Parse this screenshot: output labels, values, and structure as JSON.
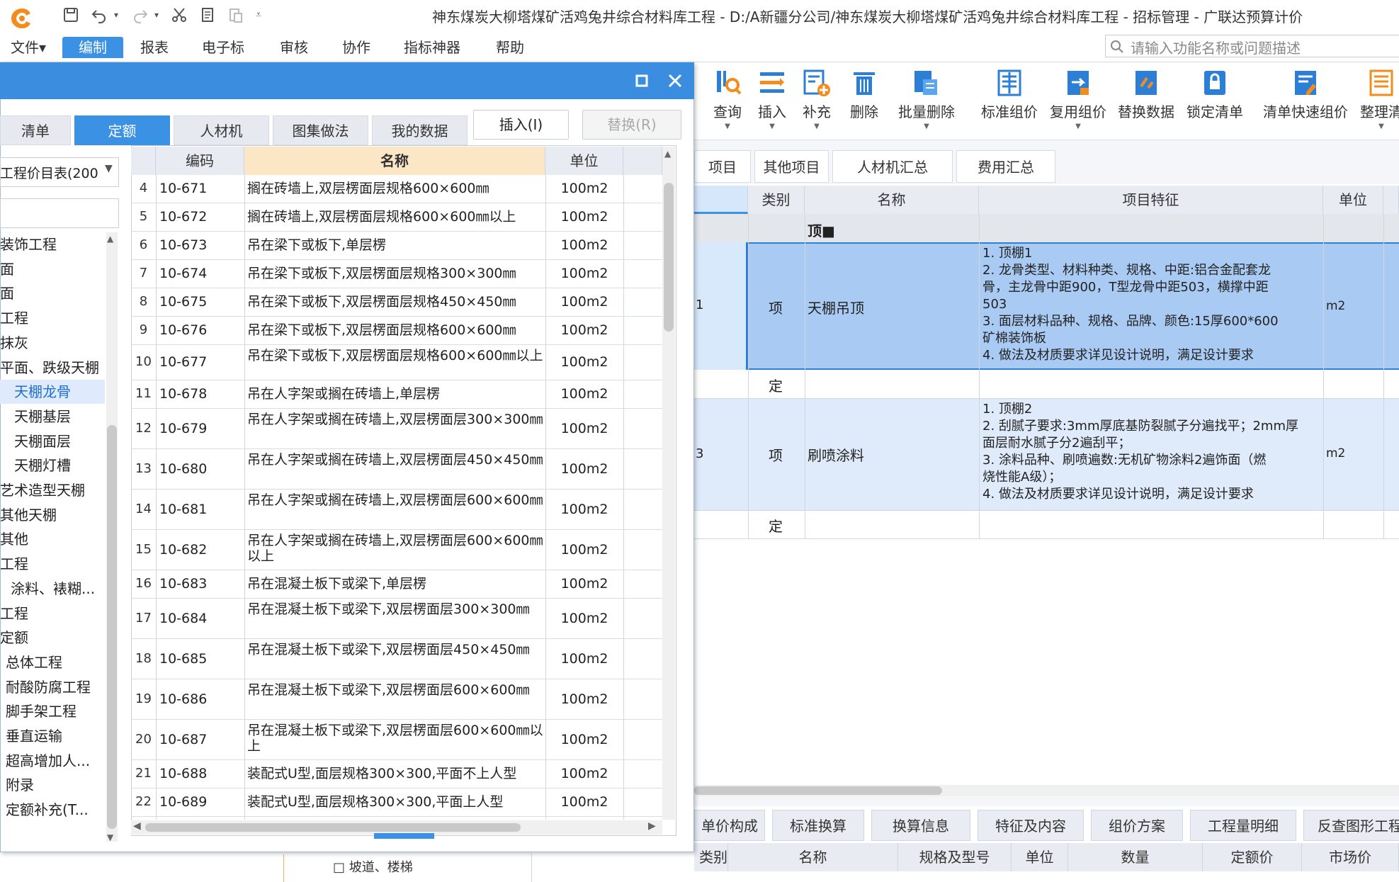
{
  "app": {
    "title": "神东煤炭大柳塔煤矿活鸡兔井综合材料库工程 - D:/A新疆分公司/神东煤炭大柳塔煤矿活鸡兔井综合材料库工程 - 招标管理 - 广联达预算计价",
    "brand_color": "#3b8de0"
  },
  "quick_access": {
    "save_icon": "save-icon",
    "undo_icon": "undo-icon",
    "redo_icon": "redo-icon",
    "cut_icon": "cut-icon",
    "copy_icon": "copy-icon",
    "paste_icon": "paste-icon",
    "more_icon": "more-icon"
  },
  "menu": {
    "items": [
      "文件▾",
      "编制",
      "报表",
      "电子标",
      "审核",
      "协作",
      "指标神器",
      "帮助"
    ],
    "active": "编制"
  },
  "search": {
    "placeholder": "请输入功能名称或问题描述"
  },
  "ribbon": {
    "buttons": [
      "查询",
      "插入",
      "补充",
      "删除",
      "批量删除",
      "标准组价",
      "复用组价",
      "替换数据",
      "锁定清单",
      "清单快速组价",
      "整理清"
    ]
  },
  "right_tabs": [
    "项目",
    "其他项目",
    "人材机汇总",
    "费用汇总"
  ],
  "right_table": {
    "headers": [
      "类别",
      "名称",
      "项目特征",
      "单位"
    ],
    "group_row": "顶■",
    "rows": [
      {
        "code_suffix": "1",
        "type": "项",
        "name": "天棚吊顶",
        "feature": [
          "1. 顶棚1",
          "2. 龙骨类型、材料种类、规格、中距:铝合金配套龙",
          "骨，主龙骨中距900，T型龙骨中距503，横撑中距",
          "503",
          "3. 面层材料品种、规格、品牌、颜色:15厚600*600",
          "矿棉装饰板",
          "4. 做法及材质要求详见设计说明，满足设计要求"
        ],
        "unit": "m2"
      },
      {
        "type": "定"
      },
      {
        "code_suffix": "3",
        "type": "项",
        "name": "刷喷涂料",
        "feature": [
          "1. 顶棚2",
          "2. 刮腻子要求:3mm厚底基防裂腻子分遍找平；2mm厚",
          "面层耐水腻子分2遍刮平；",
          "3. 涂料品种、刷喷遍数:无机矿物涂料2遍饰面（燃",
          "烧性能A级）；",
          "4. 做法及材质要求详见设计说明，满足设计要求"
        ],
        "unit": "m2"
      },
      {
        "type": "定"
      }
    ]
  },
  "bottom_tabs": [
    "单价构成",
    "标准换算",
    "换算信息",
    "特征及内容",
    "组价方案",
    "工程量明细",
    "反查图形工程"
  ],
  "bottom_headers": [
    "类别",
    "名称",
    "规格及型号",
    "单位",
    "数量",
    "定额价",
    "市场价"
  ],
  "dialog": {
    "tabs": [
      "清单",
      "定额",
      "人材机",
      "图集做法",
      "我的数据"
    ],
    "active_tab": "定额",
    "insert_label": "插入(I)",
    "replace_label": "替换(R)",
    "restore_icon": "restore-icon",
    "close_icon": "close-icon",
    "library_select": "工程价目表(200",
    "tree": [
      {
        "label": "装饰工程",
        "sel": false
      },
      {
        "label": "面",
        "sel": false
      },
      {
        "label": "面",
        "sel": false
      },
      {
        "label": "工程",
        "sel": false
      },
      {
        "label": "抹灰",
        "sel": false
      },
      {
        "label": "平面、跌级天棚",
        "sel": false
      },
      {
        "label": "天棚龙骨",
        "sel": true
      },
      {
        "label": "天棚基层",
        "sel": false
      },
      {
        "label": "天棚面层",
        "sel": false
      },
      {
        "label": "天棚灯槽",
        "sel": false
      },
      {
        "label": "艺术造型天棚",
        "sel": false
      },
      {
        "label": "其他天棚",
        "sel": false
      },
      {
        "label": "其他",
        "sel": false
      },
      {
        "label": "工程",
        "sel": false
      },
      {
        "label": "涂料、裱糊...",
        "sel": false
      },
      {
        "label": "工程",
        "sel": false
      },
      {
        "label": "定额",
        "sel": false
      },
      {
        "label": "总体工程",
        "sel": false
      },
      {
        "label": "耐酸防腐工程",
        "sel": false
      },
      {
        "label": "脚手架工程",
        "sel": false
      },
      {
        "label": "垂直运输",
        "sel": false
      },
      {
        "label": "超高增加人...",
        "sel": false
      },
      {
        "label": "附录",
        "sel": false
      },
      {
        "label": "定额补充(T...",
        "sel": false
      }
    ],
    "table_headers": [
      "编码",
      "名称",
      "单位"
    ],
    "rows": [
      {
        "n": "4",
        "code": "10-671",
        "name": "搁在砖墙上,双层楞面层规格600×600㎜",
        "unit": "100m2"
      },
      {
        "n": "5",
        "code": "10-672",
        "name": "搁在砖墙上,双层楞面层规格600×600㎜以上",
        "unit": "100m2"
      },
      {
        "n": "6",
        "code": "10-673",
        "name": "吊在梁下或板下,单层楞",
        "unit": "100m2"
      },
      {
        "n": "7",
        "code": "10-674",
        "name": "吊在梁下或板下,双层楞面层规格300×300㎜",
        "unit": "100m2"
      },
      {
        "n": "8",
        "code": "10-675",
        "name": "吊在梁下或板下,双层楞面层规格450×450㎜",
        "unit": "100m2"
      },
      {
        "n": "9",
        "code": "10-676",
        "name": "吊在梁下或板下,双层楞面层规格600×600㎜",
        "unit": "100m2"
      },
      {
        "n": "10",
        "code": "10-677",
        "name": "吊在梁下或板下,双层楞面层规格600×600㎜以上",
        "unit": "100m2"
      },
      {
        "n": "11",
        "code": "10-678",
        "name": "吊在人字架或搁在砖墙上,单层楞",
        "unit": "100m2"
      },
      {
        "n": "12",
        "code": "10-679",
        "name": "吊在人字架或搁在砖墙上,双层楞面层300×300㎜",
        "unit": "100m2"
      },
      {
        "n": "13",
        "code": "10-680",
        "name": "吊在人字架或搁在砖墙上,双层楞面层450×450㎜",
        "unit": "100m2"
      },
      {
        "n": "14",
        "code": "10-681",
        "name": "吊在人字架或搁在砖墙上,双层楞面层600×600㎜",
        "unit": "100m2"
      },
      {
        "n": "15",
        "code": "10-682",
        "name": "吊在人字架或搁在砖墙上,双层楞面层600×600㎜以上",
        "unit": "100m2"
      },
      {
        "n": "16",
        "code": "10-683",
        "name": "吊在混凝土板下或梁下,单层楞",
        "unit": "100m2"
      },
      {
        "n": "17",
        "code": "10-684",
        "name": "吊在混凝土板下或梁下,双层楞面层300×300㎜",
        "unit": "100m2"
      },
      {
        "n": "18",
        "code": "10-685",
        "name": "吊在混凝土板下或梁下,双层楞面层450×450㎜",
        "unit": "100m2"
      },
      {
        "n": "19",
        "code": "10-686",
        "name": "吊在混凝土板下或梁下,双层楞面层600×600㎜",
        "unit": "100m2"
      },
      {
        "n": "20",
        "code": "10-687",
        "name": "吊在混凝土板下或梁下,双层楞面层600×600㎜以上",
        "unit": "100m2"
      },
      {
        "n": "21",
        "code": "10-688",
        "name": "装配式U型,面层规格300×300,平面不上人型",
        "unit": "100m2"
      },
      {
        "n": "22",
        "code": "10-689",
        "name": "装配式U型,面层规格300×300,平面上人型",
        "unit": "100m2"
      }
    ]
  },
  "under_dialog_text": "坡道、楼梯"
}
